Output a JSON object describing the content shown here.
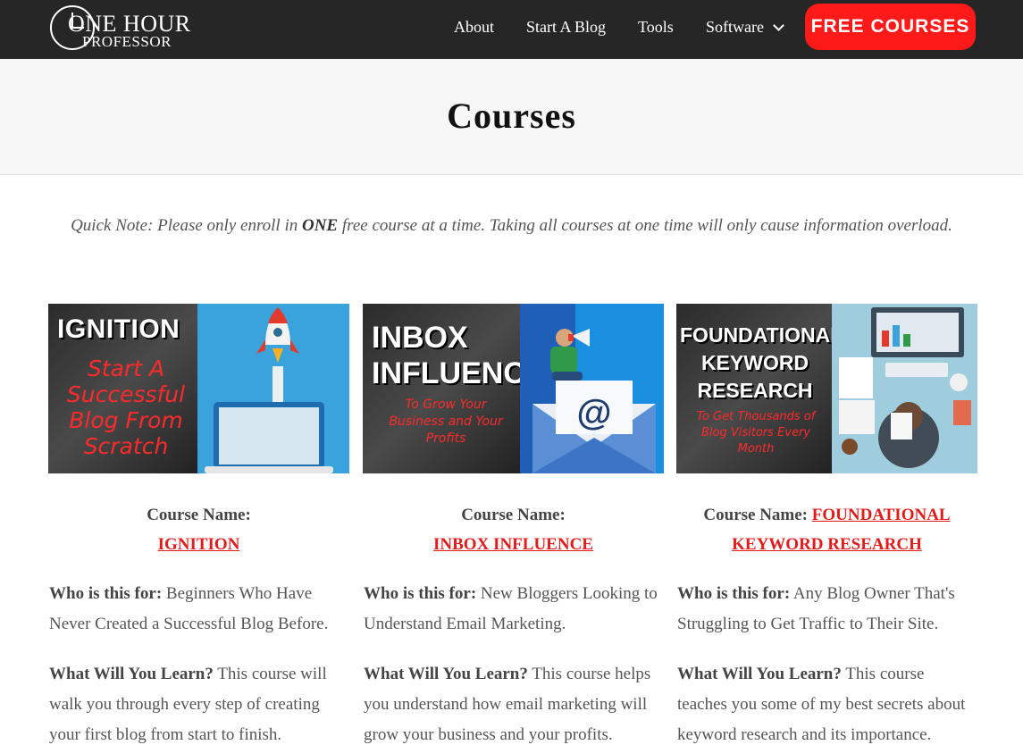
{
  "header": {
    "logo_line1": "ONE HOUR",
    "logo_line2": "PROFESSOR",
    "nav": {
      "about": "About",
      "start_blog": "Start A Blog",
      "tools": "Tools",
      "software": "Software"
    },
    "cta_label": "FREE COURSES"
  },
  "page": {
    "title": "Courses",
    "note_prefix": "Quick Note:  Please only enroll in ",
    "note_emph": "ONE",
    "note_suffix": " free course at a time.  Taking all courses at one time will only cause information overload."
  },
  "courses": [
    {
      "thumb_title": "IGNITION",
      "thumb_tagline": "Start A Successful Blog From Scratch",
      "name_label": "Course Name:",
      "name": "IGNITION",
      "who_label": "Who is this for:",
      "who_text": " Beginners Who Have Never Created a Successful Blog Before.",
      "learn_label": "What Will You Learn?",
      "learn_text": "  This course will walk you through every step of creating your first blog from start to finish."
    },
    {
      "thumb_title": "INBOX INFLUENCE",
      "thumb_tagline": "To Grow Your Business and Your Profits",
      "name_label": "Course Name:",
      "name": "INBOX INFLUENCE",
      "who_label": "Who is this for:",
      "who_text": "  New Bloggers Looking to Understand Email Marketing.",
      "learn_label": "What Will You Learn?",
      "learn_text": "  This course helps you understand how email marketing will grow your business and your profits."
    },
    {
      "thumb_title": "FOUNDATIONAL KEYWORD RESEARCH",
      "thumb_tagline": "To Get Thousands of Blog Visitors Every Month",
      "name_label": "Course Name: ",
      "name": "FOUNDATIONAL KEYWORD RESEARCH",
      "who_label": "Who is this for:",
      "who_text": "  Any Blog Owner That's Struggling to Get Traffic to Their Site.",
      "learn_label": "What Will You Learn?",
      "learn_text": "  This course teaches you some of my best secrets about keyword research and its importance."
    }
  ],
  "colors": {
    "header_bg": "#262626",
    "cta_bg": "#ff1a1a",
    "link_red": "#e21b1b",
    "title_band": "#f7f7f7"
  },
  "icons": [
    "clock-logo-icon",
    "chevron-down-icon",
    "rocket-icon",
    "laptop-icon",
    "megaphone-icon",
    "envelope-icon",
    "at-sign-icon"
  ]
}
